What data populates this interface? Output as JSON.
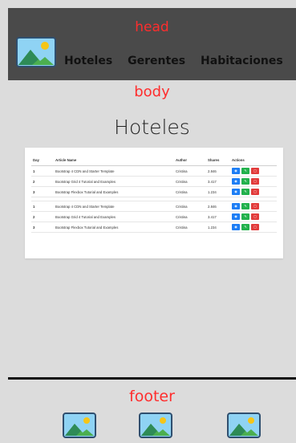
{
  "head": {
    "region_label": "head",
    "nav": [
      "Hoteles",
      "Gerentes",
      "Habitaciones"
    ]
  },
  "body": {
    "region_label": "body",
    "title": "Hoteles",
    "table": {
      "columns": [
        "Day",
        "Article Name",
        "Author",
        "Shares",
        "Actions"
      ],
      "rows": [
        [
          "1",
          "Bootstrap 4 CDN and Starter Template",
          "Cristina",
          "2.846"
        ],
        [
          "2",
          "Bootstrap Grid 4 Tutorial and Examples",
          "Cristina",
          "3.417"
        ],
        [
          "3",
          "Bootstrap Flexbox Tutorial and Examples",
          "Cristina",
          "1.234"
        ],
        [
          "1",
          "Bootstrap 4 CDN and Starter Template",
          "Cristina",
          "2.846"
        ],
        [
          "2",
          "Bootstrap Grid 4 Tutorial and Examples",
          "Cristina",
          "3.417"
        ],
        [
          "3",
          "Bootstrap Flexbox Tutorial and Examples",
          "Cristina",
          "1.234"
        ]
      ],
      "action_icons": [
        "eye-icon",
        "edit-icon",
        "trash-icon"
      ]
    }
  },
  "footer": {
    "region_label": "footer",
    "icons": [
      "image-icon",
      "image-icon",
      "image-icon"
    ]
  },
  "colors": {
    "head_bg": "#4a4a4a",
    "page_bg": "#dcdcdc",
    "label_red": "#ff2d2d",
    "view_blue": "#1e7ef5",
    "edit_green": "#22b14c",
    "delete_red": "#e23b3b"
  }
}
